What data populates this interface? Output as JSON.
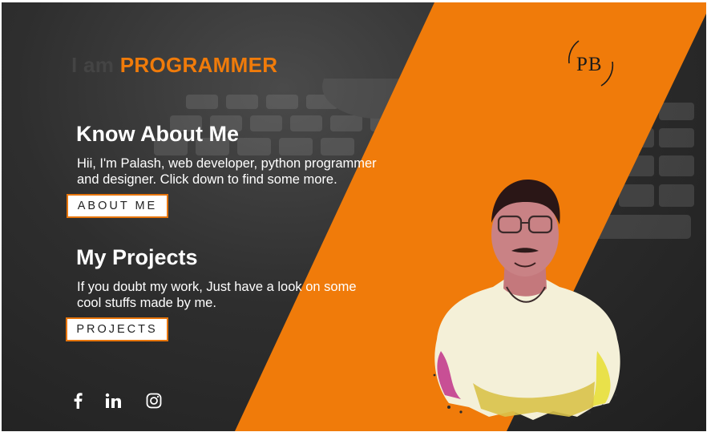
{
  "header": {
    "prefix": "I am",
    "role": "PROGRAMMER",
    "logo_text": "PB"
  },
  "about": {
    "heading": "Know About Me",
    "text_line1": "Hii, I'm Palash, web developer, python programmer",
    "text_line2": "and designer. Click down to find some more.",
    "button_label": "ABOUT ME"
  },
  "projects": {
    "heading": "My Projects",
    "text_line1": "If you doubt my work, Just have a look on some",
    "text_line2": "cool stuffs made by me.",
    "button_label": "PROJECTS"
  },
  "social": [
    "facebook-icon",
    "linkedin-icon",
    "instagram-icon"
  ],
  "colors": {
    "accent": "#f07b0a",
    "background": "#2a2a2a",
    "text": "#ffffff"
  }
}
